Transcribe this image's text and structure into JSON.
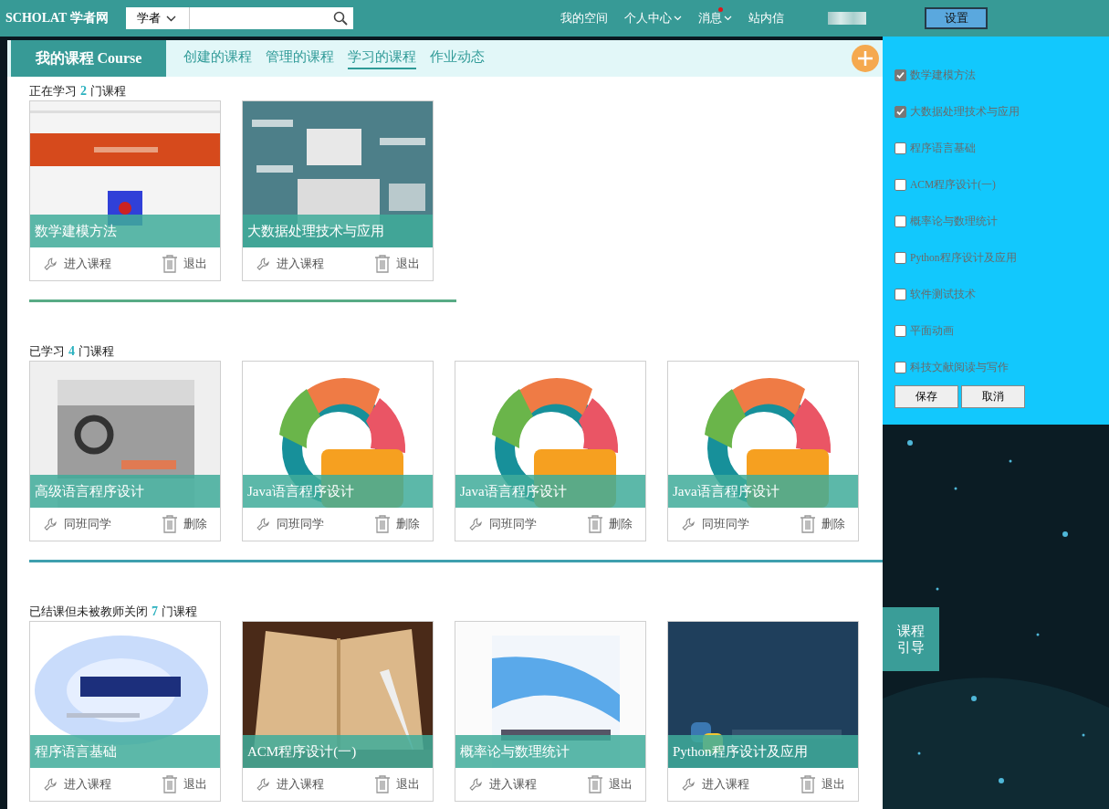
{
  "topbar": {
    "logo": "SCHOLAT 学者网",
    "search_scope": "学者",
    "nav": [
      {
        "label": "我的空间",
        "dropdown": false,
        "badge": false
      },
      {
        "label": "个人中心",
        "dropdown": true,
        "badge": false
      },
      {
        "label": "消息",
        "dropdown": true,
        "badge": true
      },
      {
        "label": "站内信",
        "dropdown": false,
        "badge": false
      }
    ],
    "settings_button": "设置"
  },
  "course_header": {
    "title": "我的课程 Course",
    "tabs": [
      {
        "label": "创建的课程",
        "selected": false
      },
      {
        "label": "管理的课程",
        "selected": false
      },
      {
        "label": "学习的课程",
        "selected": true
      },
      {
        "label": "作业动态",
        "selected": false
      }
    ]
  },
  "sections": [
    {
      "prefix": "正在学习",
      "count": "2",
      "suffix": "门课程",
      "courses": [
        {
          "title": "数学建模方法",
          "actions": [
            {
              "kind": "open",
              "label": "进入课程"
            },
            {
              "kind": "remove",
              "label": "退出"
            }
          ]
        },
        {
          "title": "大数据处理技术与应用",
          "actions": [
            {
              "kind": "open",
              "label": "进入课程"
            },
            {
              "kind": "remove",
              "label": "退出"
            }
          ]
        }
      ]
    },
    {
      "prefix": "已学习",
      "count": "4",
      "suffix": "门课程",
      "courses": [
        {
          "title": "高级语言程序设计",
          "actions": [
            {
              "kind": "open",
              "label": "同班同学"
            },
            {
              "kind": "remove",
              "label": "删除"
            }
          ]
        },
        {
          "title": "Java语言程序设计",
          "actions": [
            {
              "kind": "open",
              "label": "同班同学"
            },
            {
              "kind": "remove",
              "label": "删除"
            }
          ]
        },
        {
          "title": "Java语言程序设计",
          "actions": [
            {
              "kind": "open",
              "label": "同班同学"
            },
            {
              "kind": "remove",
              "label": "删除"
            }
          ]
        },
        {
          "title": "Java语言程序设计",
          "actions": [
            {
              "kind": "open",
              "label": "同班同学"
            },
            {
              "kind": "remove",
              "label": "删除"
            }
          ]
        }
      ]
    },
    {
      "prefix": "已结课但未被教师关闭",
      "count": "7",
      "suffix": "门课程",
      "courses": [
        {
          "title": "程序语言基础",
          "actions": [
            {
              "kind": "open",
              "label": "进入课程"
            },
            {
              "kind": "remove",
              "label": "退出"
            }
          ]
        },
        {
          "title": "ACM程序设计(一)",
          "actions": [
            {
              "kind": "open",
              "label": "进入课程"
            },
            {
              "kind": "remove",
              "label": "退出"
            }
          ]
        },
        {
          "title": "概率论与数理统计",
          "actions": [
            {
              "kind": "open",
              "label": "进入课程"
            },
            {
              "kind": "remove",
              "label": "退出"
            }
          ]
        },
        {
          "title": "Python程序设计及应用",
          "actions": [
            {
              "kind": "open",
              "label": "进入课程"
            },
            {
              "kind": "remove",
              "label": "退出"
            }
          ]
        }
      ]
    }
  ],
  "settings_panel": {
    "options": [
      {
        "label": "数学建模方法",
        "checked": true
      },
      {
        "label": "大数据处理技术与应用",
        "checked": true
      },
      {
        "label": "程序语言基础",
        "checked": false
      },
      {
        "label": "ACM程序设计(一)",
        "checked": false
      },
      {
        "label": "概率论与数理统计",
        "checked": false
      },
      {
        "label": "Python程序设计及应用",
        "checked": false
      },
      {
        "label": "软件测试技术",
        "checked": false
      },
      {
        "label": "平面动画",
        "checked": false
      },
      {
        "label": "科技文献阅读与写作",
        "checked": false
      }
    ],
    "buttons": [
      "保存",
      "取消"
    ]
  },
  "guide_tab": "课程引导"
}
